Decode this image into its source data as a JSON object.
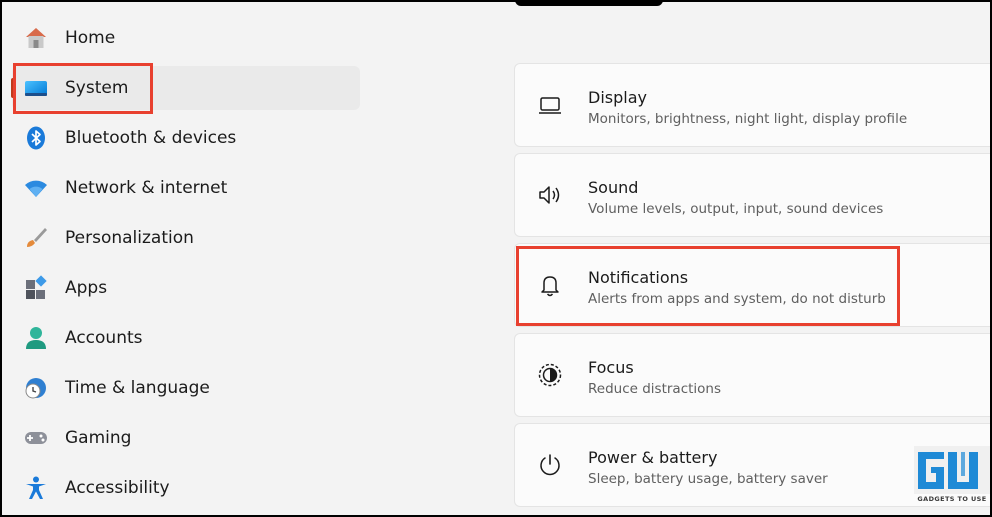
{
  "sidebar": {
    "items": [
      {
        "label": "Home",
        "icon": "home-icon"
      },
      {
        "label": "System",
        "icon": "system-icon",
        "active": true
      },
      {
        "label": "Bluetooth & devices",
        "icon": "bluetooth-icon"
      },
      {
        "label": "Network & internet",
        "icon": "wifi-icon"
      },
      {
        "label": "Personalization",
        "icon": "brush-icon"
      },
      {
        "label": "Apps",
        "icon": "apps-icon"
      },
      {
        "label": "Accounts",
        "icon": "account-icon"
      },
      {
        "label": "Time & language",
        "icon": "clock-globe-icon"
      },
      {
        "label": "Gaming",
        "icon": "gamepad-icon"
      },
      {
        "label": "Accessibility",
        "icon": "accessibility-icon"
      }
    ]
  },
  "main": {
    "cards": [
      {
        "title": "Display",
        "subtitle": "Monitors, brightness, night light, display profile",
        "icon": "monitor-icon"
      },
      {
        "title": "Sound",
        "subtitle": "Volume levels, output, input, sound devices",
        "icon": "speaker-icon"
      },
      {
        "title": "Notifications",
        "subtitle": "Alerts from apps and system, do not disturb",
        "icon": "bell-icon"
      },
      {
        "title": "Focus",
        "subtitle": "Reduce distractions",
        "icon": "focus-icon"
      },
      {
        "title": "Power & battery",
        "subtitle": "Sleep, battery usage, battery saver",
        "icon": "power-icon"
      }
    ]
  },
  "watermark": {
    "text": "GADGETS TO USE"
  },
  "colors": {
    "highlight": "#e8402f",
    "accent": "#0067c0",
    "background": "#f3f3f3",
    "card": "#fbfbfb"
  }
}
